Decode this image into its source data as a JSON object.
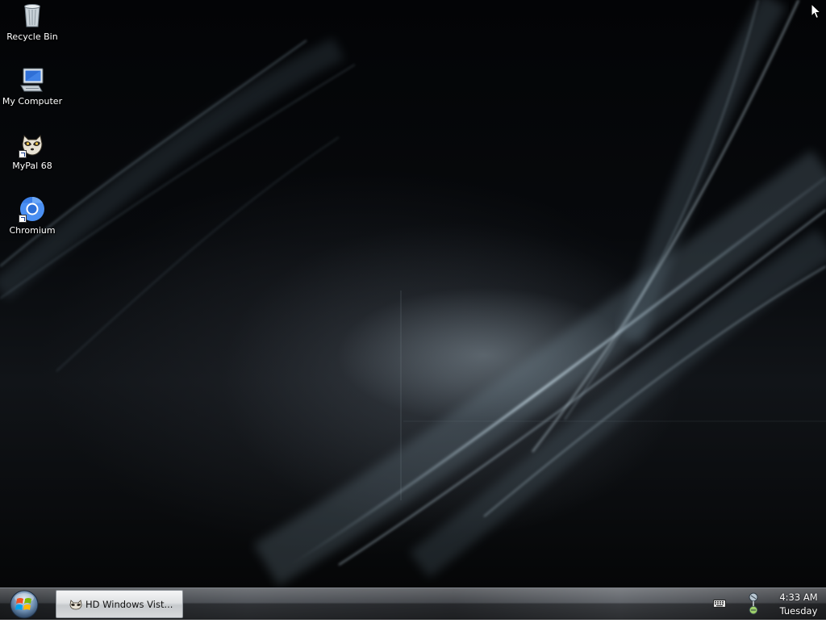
{
  "desktop": {
    "icons": [
      {
        "label": "Recycle Bin",
        "icon": "recycle-bin-icon"
      },
      {
        "label": "My Computer",
        "icon": "computer-icon"
      },
      {
        "label": "MyPal 68",
        "icon": "mypal-raccoon-icon",
        "shortcut": true
      },
      {
        "label": "Chromium",
        "icon": "chromium-icon",
        "shortcut": true
      }
    ]
  },
  "taskbar": {
    "start_icon": "windows-orb-icon",
    "task_button": {
      "label": "HD Windows Vist...",
      "icon": "mypal-raccoon-icon"
    },
    "tray": {
      "keyboard_icon": "keyboard-icon",
      "network_icon": "network-icon",
      "time": "4:33 AM",
      "day": "Tuesday"
    }
  },
  "colors": {
    "desktop_bg": "#05070a",
    "taskbar": "#3a3d42",
    "task_button": "#dfe1e3",
    "label_text": "#ffffff"
  }
}
